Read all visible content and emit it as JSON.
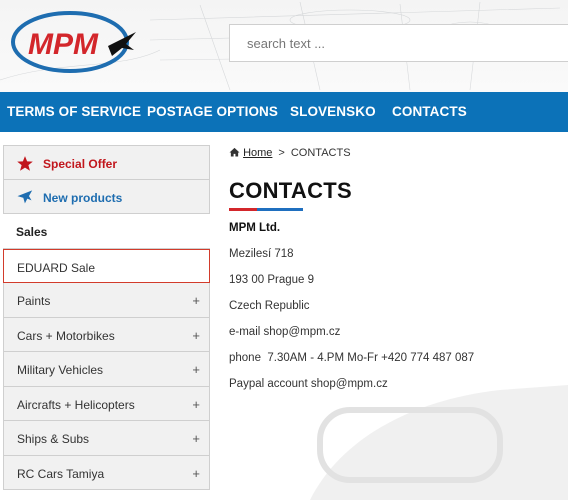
{
  "brand": {
    "logo_text": "MPM"
  },
  "search": {
    "placeholder": "search text ..."
  },
  "nav": {
    "items": [
      {
        "label": "TERMS OF SERVICE"
      },
      {
        "label": "POSTAGE OPTIONS"
      },
      {
        "label": "SLOVENSKO"
      },
      {
        "label": "CONTACTS"
      }
    ]
  },
  "sidebar": {
    "items": [
      {
        "label": "Special Offer",
        "icon": "star-icon"
      },
      {
        "label": "New products",
        "icon": "airplane-icon"
      },
      {
        "label": "Sales"
      },
      {
        "label": "EDUARD Sale"
      },
      {
        "label": "Paints",
        "expand": "+"
      },
      {
        "label": "Cars + Motorbikes",
        "expand": "+"
      },
      {
        "label": "Military Vehicles",
        "expand": "+"
      },
      {
        "label": "Aircrafts + Helicopters",
        "expand": "+"
      },
      {
        "label": "Ships & Subs",
        "expand": "+"
      },
      {
        "label": "RC Cars Tamiya",
        "expand": "+"
      }
    ]
  },
  "breadcrumb": {
    "home": "Home",
    "separator": ">",
    "current": "CONTACTS"
  },
  "main": {
    "title": "CONTACTS",
    "lines": [
      "MPM Ltd.",
      "Mezilesí 718",
      "193 00 Prague 9",
      "Czech Republic",
      "e-mail shop@mpm.cz",
      "phone  7.30AM - 4.PM Mo-Fr +420 774 487 087",
      "Paypal account shop@mpm.cz"
    ]
  },
  "colors": {
    "nav_bg": "#0c72b8",
    "accent_red": "#c1161c",
    "accent_blue": "#1e6db0"
  }
}
